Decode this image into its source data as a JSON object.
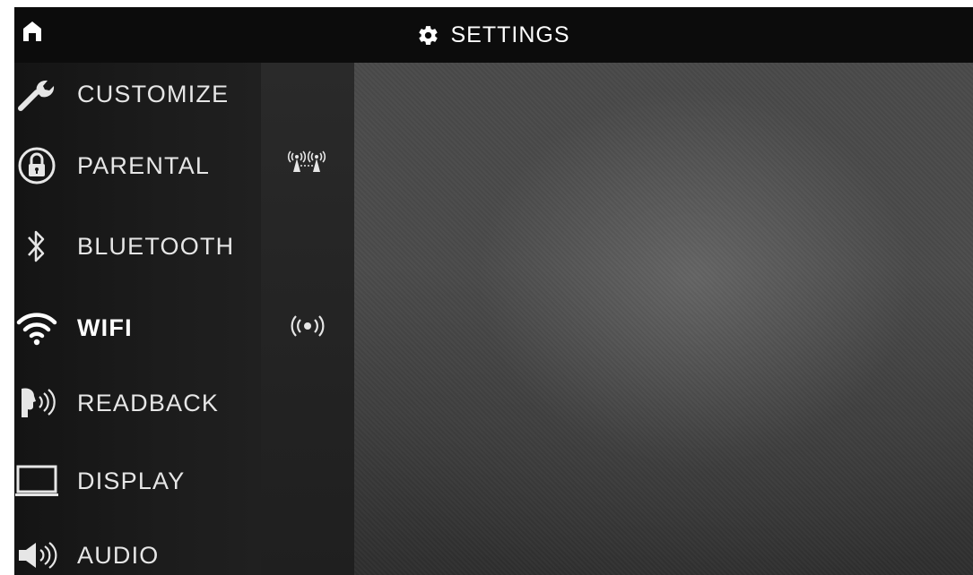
{
  "header": {
    "title": "SETTINGS",
    "home_icon": "home-icon",
    "settings_icon": "gear-icon"
  },
  "menu": {
    "items": [
      {
        "label": "CUSTOMIZE",
        "icon": "wrench-icon",
        "active": false
      },
      {
        "label": "PARENTAL",
        "icon": "lock-icon",
        "active": false
      },
      {
        "label": "BLUETOOTH",
        "icon": "bluetooth-icon",
        "active": false
      },
      {
        "label": "WIFI",
        "icon": "wifi-icon",
        "active": true
      },
      {
        "label": "READBACK",
        "icon": "speaking-head-icon",
        "active": false
      },
      {
        "label": "DISPLAY",
        "icon": "monitor-icon",
        "active": false
      },
      {
        "label": "AUDIO",
        "icon": "speaker-icon",
        "active": false
      }
    ]
  },
  "submenu": {
    "items": [
      {
        "icon": "network-towers-icon"
      },
      {
        "icon": "broadcast-icon"
      }
    ]
  },
  "colors": {
    "text": "#e6e6e6",
    "active_text": "#ffffff",
    "topbar": "#0c0c0c",
    "content": "#4a4a4a"
  }
}
